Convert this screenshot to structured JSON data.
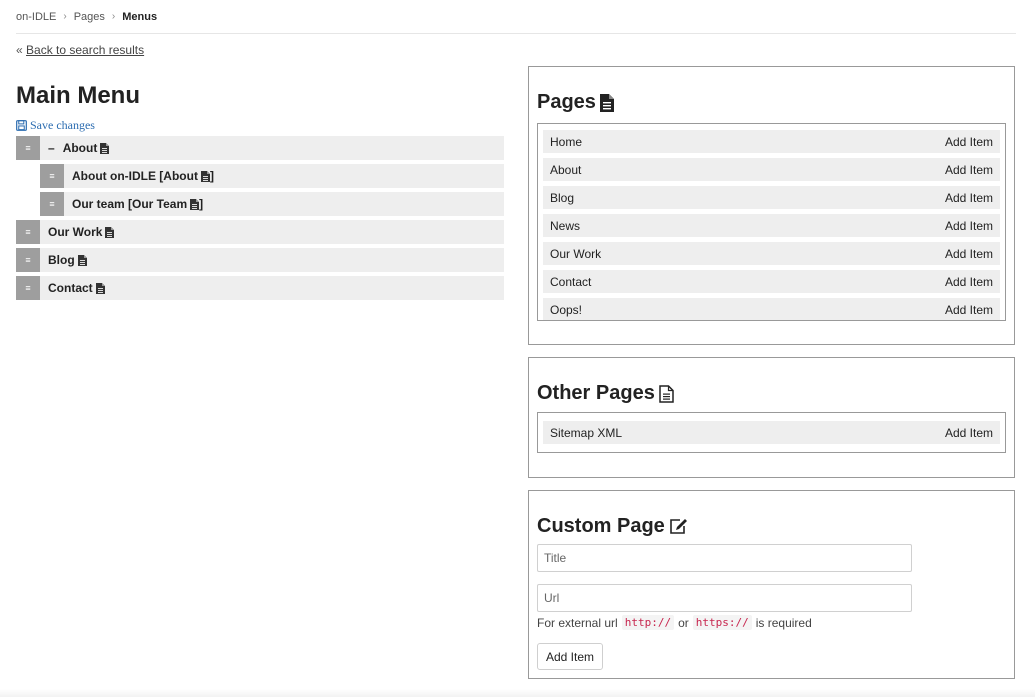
{
  "breadcrumb": {
    "items": [
      "on-IDLE",
      "Pages",
      "Menus"
    ],
    "separator": "›"
  },
  "back_link": {
    "prefix": "«",
    "label": "Back to search results"
  },
  "main_menu": {
    "title": "Main Menu",
    "save_label": "Save changes",
    "collapse_symbol": "–",
    "handle_symbol": "≡",
    "items": [
      {
        "label": "About",
        "level": 0
      },
      {
        "label": "About on-IDLE [About",
        "level": 1
      },
      {
        "label": "Our team [Our Team",
        "level": 1
      },
      {
        "label": "Our Work",
        "level": 0
      },
      {
        "label": "Blog",
        "level": 0
      },
      {
        "label": "Contact",
        "level": 0
      }
    ],
    "trailing_bracket": "]"
  },
  "pages_panel": {
    "title": "Pages",
    "add_label": "Add Item",
    "items": [
      "Home",
      "About",
      "Blog",
      "News",
      "Our Work",
      "Contact",
      "Oops!"
    ]
  },
  "other_pages_panel": {
    "title": "Other Pages",
    "add_label": "Add Item",
    "items": [
      "Sitemap XML"
    ]
  },
  "custom_page_panel": {
    "title": "Custom Page",
    "title_placeholder": "Title",
    "url_placeholder": "Url",
    "help_prefix": "For external url",
    "help_code_1": "http://",
    "help_or": "or",
    "help_code_2": "https://",
    "help_suffix": "is required",
    "button_label": "Add Item"
  },
  "colors": {
    "link_blue": "#2b6cb0",
    "handle_gray": "#9e9e9e",
    "row_gray": "#eeeeee",
    "code_red": "#c7254e"
  }
}
